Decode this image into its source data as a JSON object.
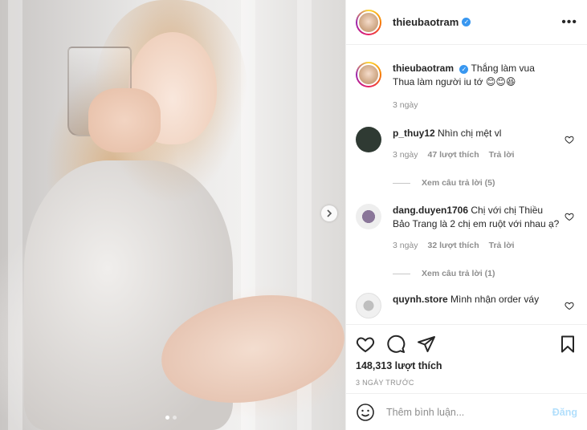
{
  "post": {
    "username": "thieubaotram",
    "verified_icon": "verified-badge-icon",
    "more_icon": "more-options-icon",
    "caption_line1": "Thắng làm vua",
    "caption_line2": "Thua làm người iu tớ 😊😊😆",
    "caption_time": "3 ngày",
    "carousel_total": 2,
    "carousel_current": 1
  },
  "comments": [
    {
      "username": "p_thuy12",
      "text": "Nhìn chị mệt vl",
      "time": "3 ngày",
      "likes": "47 lượt thích",
      "reply": "Trả lời",
      "view_replies": "Xem câu trả lời (5)",
      "avatar_color": "#2f3a33"
    },
    {
      "username": "dang.duyen1706",
      "text": "Chị với chị Thiều Bảo Trang là 2 chị em ruột với nhau ạ?",
      "time": "3 ngày",
      "likes": "32 lượt thích",
      "reply": "Trả lời",
      "view_replies": "Xem câu trả lời (1)",
      "avatar_color": "#9b8aa6"
    },
    {
      "username": "quynh.store",
      "text": "Mình nhận order váy",
      "avatar_color": "#d9d9d9"
    }
  ],
  "actions": {
    "likes": "148,313 lượt thích",
    "time_ago": "3 NGÀY TRƯỚC"
  },
  "add_comment": {
    "placeholder": "Thêm bình luận...",
    "post_label": "Đăng"
  },
  "colors": {
    "accent": "#3897f0",
    "muted": "#8e8e8e",
    "post_disabled": "#b2dffc"
  }
}
